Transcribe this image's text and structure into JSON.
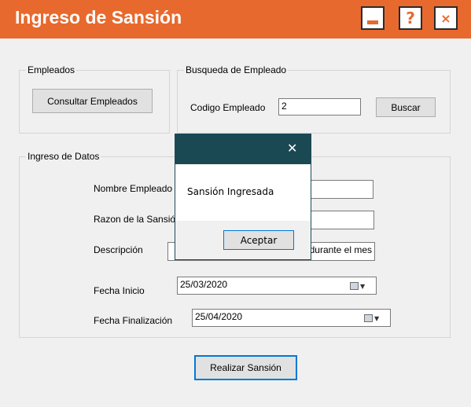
{
  "window": {
    "title": "Ingreso de Sansión",
    "minimize_icon": "minimize-icon",
    "help_glyph": "?",
    "close_glyph": "×"
  },
  "empleados_group": {
    "legend": "Empleados",
    "consult_button": "Consultar Empleados"
  },
  "busqueda_group": {
    "legend": "Busqueda de Empleado",
    "codigo_label": "Codigo Empleado",
    "codigo_value": "2",
    "buscar_button": "Buscar"
  },
  "datos_group": {
    "legend": "Ingreso de Datos",
    "nombre_label": "Nombre Empleado",
    "nombre_value": "",
    "razon_label": "Razon de la Sansión",
    "razon_value": "",
    "descripcion_label": "Descripción",
    "descripcion_value": "la... durante el mes",
    "fecha_inicio_label": "Fecha Inicio",
    "fecha_inicio_value": "25/03/2020",
    "fecha_fin_label": "Fecha Finalización",
    "fecha_fin_value": "25/04/2020",
    "calendar_icon": "calendar-icon",
    "arrow_glyph": "▼"
  },
  "realizar_button": "Realizar Sansión",
  "dialog": {
    "close_glyph": "✕",
    "message": "Sansión Ingresada",
    "ok_button": "Aceptar"
  }
}
